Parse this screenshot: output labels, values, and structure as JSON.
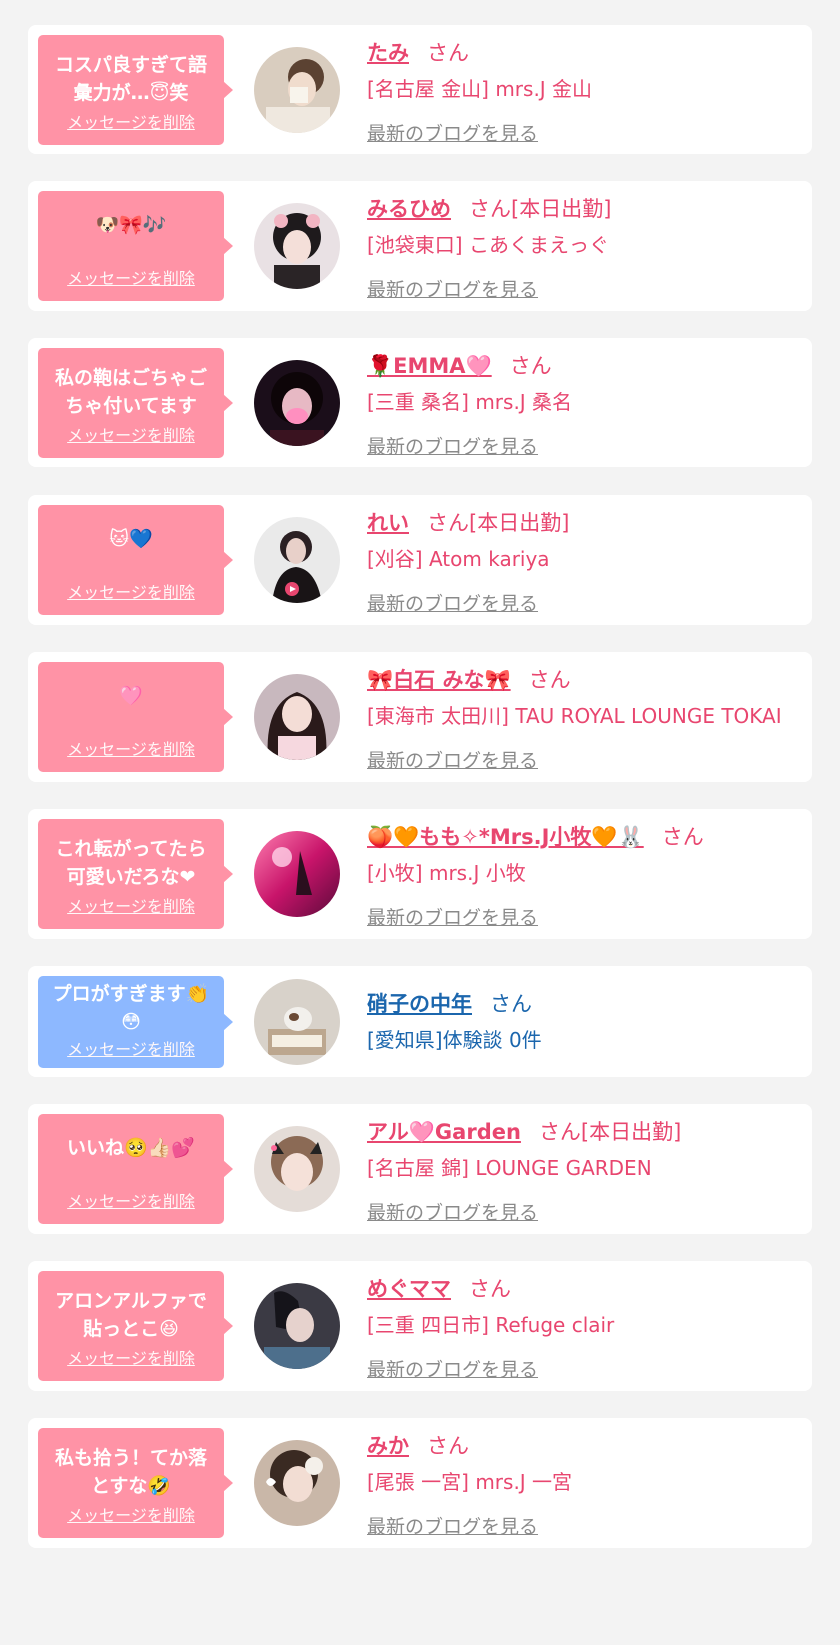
{
  "delete_label": "メッセージを削除",
  "blog_label": "最新のブログを見る",
  "colors": {
    "pink_bubble": "#ff93a6",
    "blue_bubble": "#8db8ff",
    "name_pink": "#e8466f",
    "name_blue": "#1b66ad",
    "background": "#f3f3f3"
  },
  "items": [
    {
      "message": "コスパ良すぎて語\n彙力が…😇笑",
      "name": "たみ",
      "honorific": "さん",
      "shop": "[名古屋 金山] mrs.J 金山",
      "blog": true,
      "bubble": "pink"
    },
    {
      "message": "🐶🎀🎶",
      "name": "みるひめ",
      "honorific": "さん[本日出勤]",
      "shop": "[池袋東口] こあくまえっぐ",
      "blog": true,
      "bubble": "pink"
    },
    {
      "message": "私の鞄はごちゃご\nちゃ付いてます",
      "name": "🌹EMMA🩷",
      "honorific": "さん",
      "shop": "[三重 桑名] mrs.J 桑名",
      "blog": true,
      "bubble": "pink"
    },
    {
      "message": "🐱💙",
      "name": "れい",
      "honorific": "さん[本日出勤]",
      "shop": "[刈谷] Atom kariya",
      "blog": true,
      "bubble": "pink"
    },
    {
      "message": "🩷",
      "name": "🎀白石 みな🎀",
      "honorific": "さん",
      "shop": "[東海市 太田川] TAU ROYAL LOUNGE TOKAI",
      "blog": true,
      "bubble": "pink"
    },
    {
      "message": "これ転がってたら\n可愛いだろな❤",
      "name": "🍑🧡もも✧*Mrs.J小牧🧡🐰",
      "honorific": "さん",
      "shop": "[小牧] mrs.J 小牧",
      "blog": true,
      "bubble": "pink"
    },
    {
      "message": "プロがすぎます👏\n😳",
      "name": "硝子の中年",
      "honorific": "さん",
      "shop": "[愛知県]体験談 0件",
      "blog": false,
      "bubble": "blue"
    },
    {
      "message": "いいね🥺👍🏻💕",
      "name": "アル🩷Garden",
      "honorific": "さん[本日出勤]",
      "shop": "[名古屋 錦] LOUNGE GARDEN",
      "blog": true,
      "bubble": "pink"
    },
    {
      "message": "アロンアルファで\n貼っとこ😆",
      "name": "めぐママ",
      "honorific": "さん",
      "shop": "[三重 四日市] Refuge clair",
      "blog": true,
      "bubble": "pink"
    },
    {
      "message": "私も拾う！てか落\nとすな🤣",
      "name": "みか",
      "honorific": "さん",
      "shop": "[尾張 一宮] mrs.J 一宮",
      "blog": true,
      "bubble": "pink"
    }
  ]
}
